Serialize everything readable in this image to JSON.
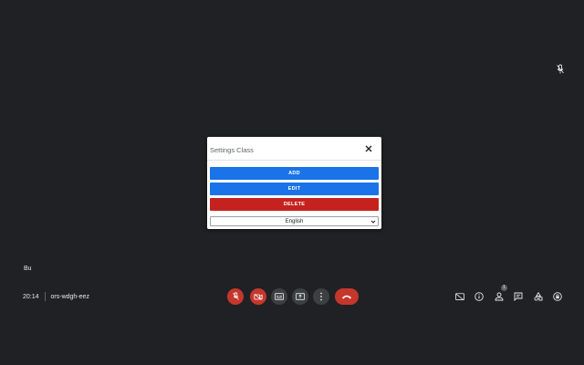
{
  "meeting": {
    "participant_name": "Bu",
    "time": "20:14",
    "code": "ors-wdgh-eez"
  },
  "dialog": {
    "title": "Settings Class",
    "add_label": "ADD",
    "edit_label": "EDIT",
    "delete_label": "DELETE",
    "language_value": "English"
  },
  "controls": {
    "items": [
      "mic-off-icon",
      "camera-off-icon",
      "captions-icon",
      "present-icon",
      "more-options-icon",
      "end-call-icon"
    ]
  },
  "right_panel": {
    "people_count": "1"
  },
  "colors": {
    "background": "#202124",
    "primary": "#1a73e8",
    "danger": "#c5221f",
    "control_red": "#c5372c"
  }
}
